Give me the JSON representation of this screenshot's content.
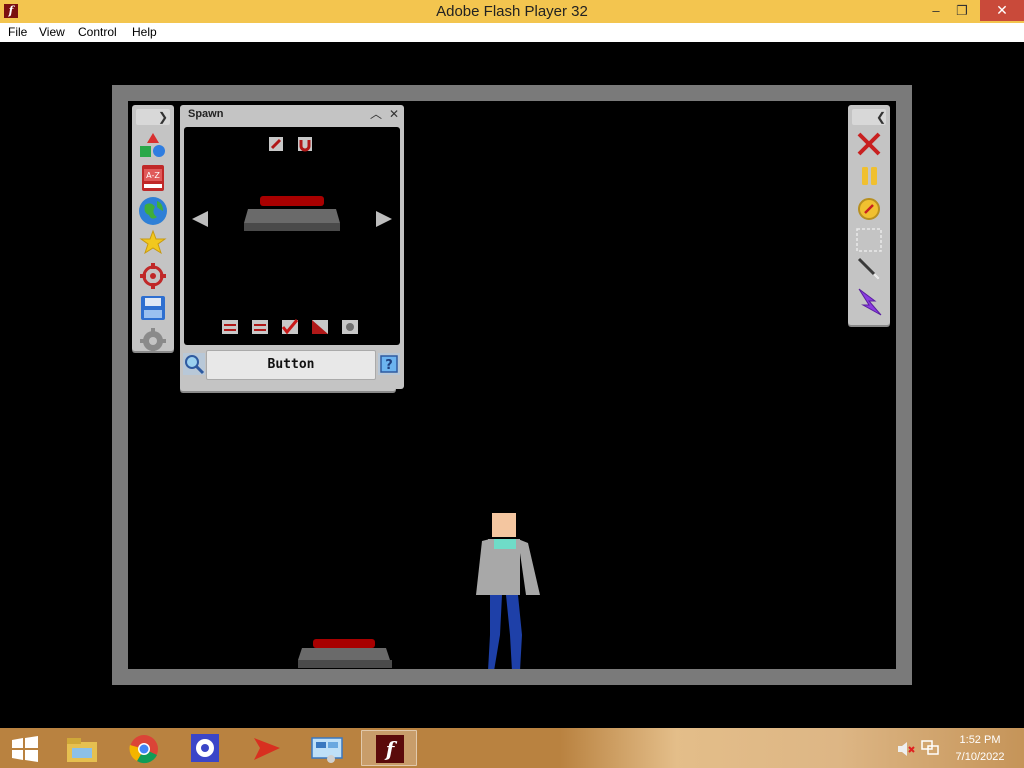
{
  "window": {
    "title": "Adobe Flash Player 32",
    "app_icon": "flash-icon",
    "controls": {
      "minimize": "–",
      "maximize": "❐",
      "close": "✕"
    }
  },
  "menubar": {
    "items": [
      {
        "label": "File"
      },
      {
        "label": "View"
      },
      {
        "label": "Control"
      },
      {
        "label": "Help"
      }
    ]
  },
  "game": {
    "left_toolbar": {
      "toggle_icon": "chevron-right-icon",
      "tools": [
        "shapes-icon",
        "a-z-book-icon",
        "globe-icon",
        "star-icon",
        "target-icon",
        "save-disk-icon",
        "gear-icon"
      ],
      "az_label": "A-Z"
    },
    "spawn_panel": {
      "title": "Spawn",
      "top_icons": [
        "wrench-icon",
        "magnet-icon"
      ],
      "prev_icon": "arrow-left-icon",
      "next_icon": "arrow-right-icon",
      "bottom_icons": [
        "flip-horizontal-icon",
        "rotate-icon",
        "check-icon",
        "half-square-icon",
        "gear-box-icon"
      ],
      "selected_item_label": "Button",
      "search_icon": "magnify-icon",
      "help_icon": "help-icon"
    },
    "right_toolbar": {
      "toggle_icon": "chevron-left-icon",
      "tools": [
        "close-x-icon",
        "pause-icon",
        "compass-icon",
        "select-box-icon",
        "wand-icon",
        "lightning-icon"
      ]
    },
    "colors": {
      "button_red": "#a80000",
      "button_base": "#5e5e5e",
      "ragdoll_skin": "#f4c6a0",
      "ragdoll_shirt": "#a8a8a8",
      "ragdoll_collar": "#6fdcc8",
      "ragdoll_pants": "#1e40a8"
    }
  },
  "taskbar": {
    "apps": [
      "windows-start-icon",
      "file-explorer-icon",
      "chrome-icon",
      "settings-gear-icon",
      "paper-plane-icon",
      "control-panel-icon",
      "flash-player-icon"
    ],
    "tray": {
      "time": "1:52 PM",
      "date": "7/10/2022"
    }
  }
}
